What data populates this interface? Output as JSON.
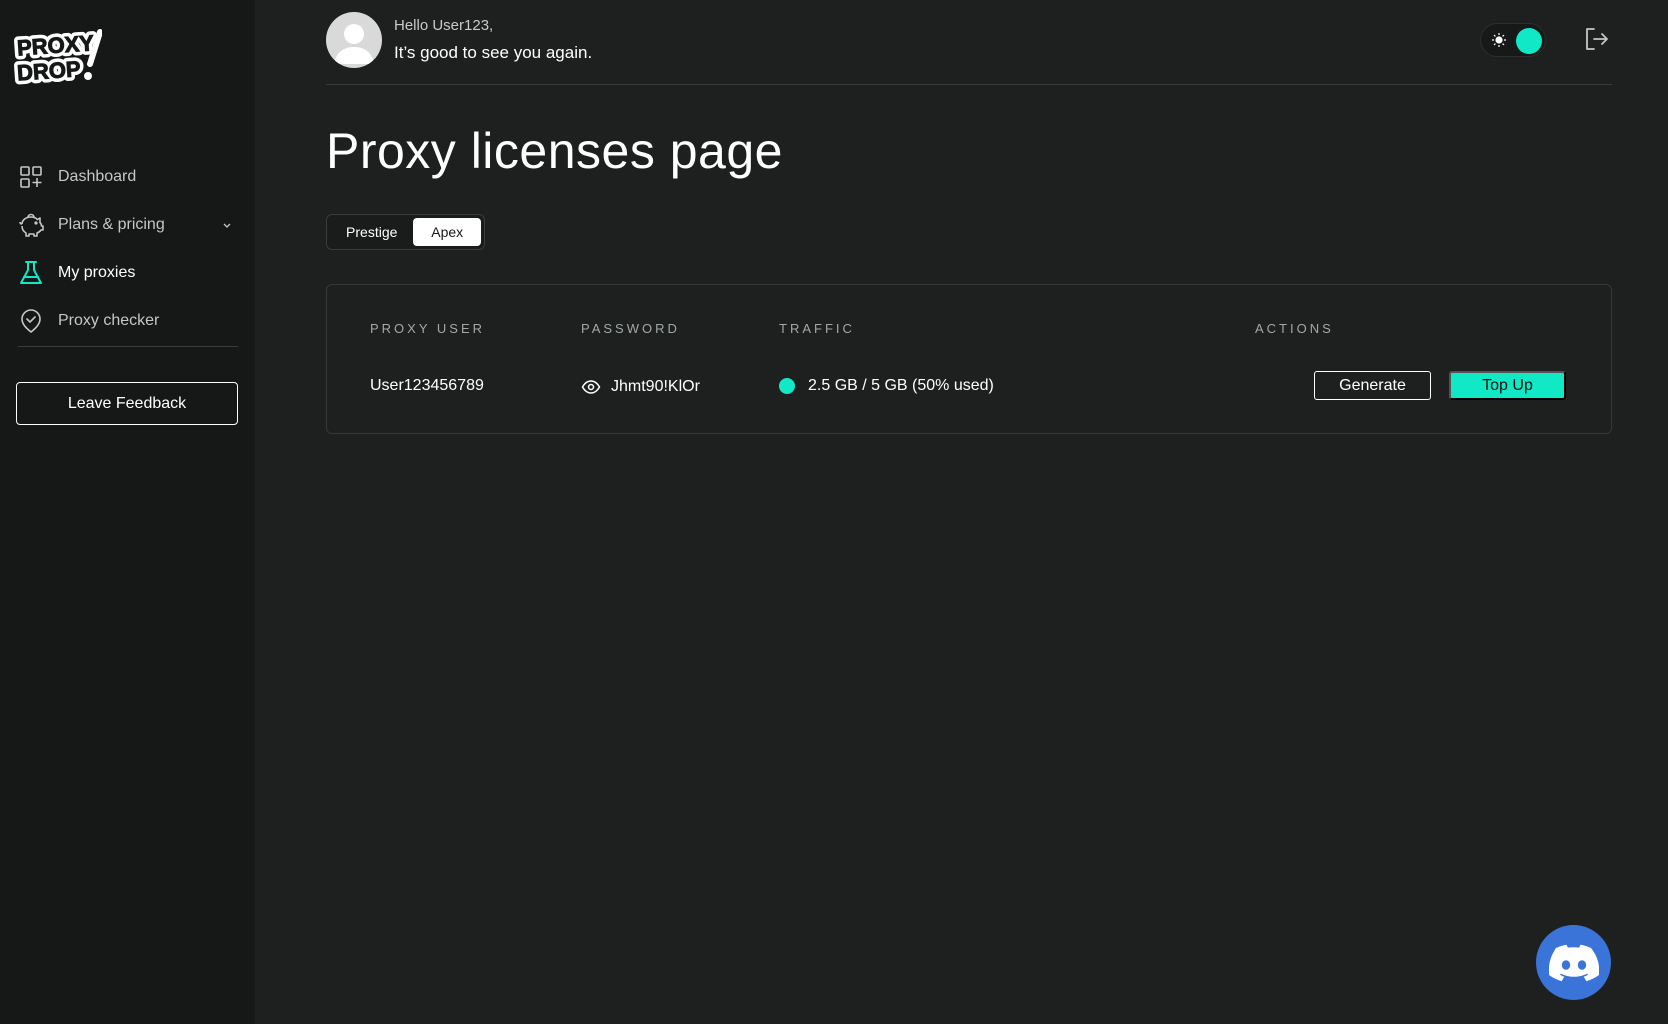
{
  "brand": {
    "logo_text": "PROXY DROP",
    "accent": "#10e8c6"
  },
  "sidebar": {
    "items": [
      {
        "label": "Dashboard",
        "icon": "dashboard-grid-icon"
      },
      {
        "label": "Plans & pricing",
        "icon": "piggy-bank-icon",
        "has_submenu": true
      },
      {
        "label": "My proxies",
        "icon": "flask-icon",
        "active": true
      },
      {
        "label": "Proxy checker",
        "icon": "shield-check-icon"
      }
    ],
    "feedback_label": "Leave Feedback"
  },
  "header": {
    "greeting": "Hello User123,",
    "subtitle": "It’s good to see you again."
  },
  "page": {
    "title": "Proxy licenses page"
  },
  "tabs": [
    {
      "label": "Prestige",
      "selected": false
    },
    {
      "label": "Apex",
      "selected": true
    }
  ],
  "table": {
    "headers": {
      "user": "PROXY USER",
      "password": "PASSWORD",
      "traffic": "TRAFFIC",
      "actions": "ACTIONS"
    },
    "rows": [
      {
        "user": "User123456789",
        "password": "Jhmt90!KlOr",
        "traffic": "2.5 GB / 5 GB (50% used)",
        "generate_label": "Generate",
        "topup_label": "Top Up"
      }
    ]
  }
}
